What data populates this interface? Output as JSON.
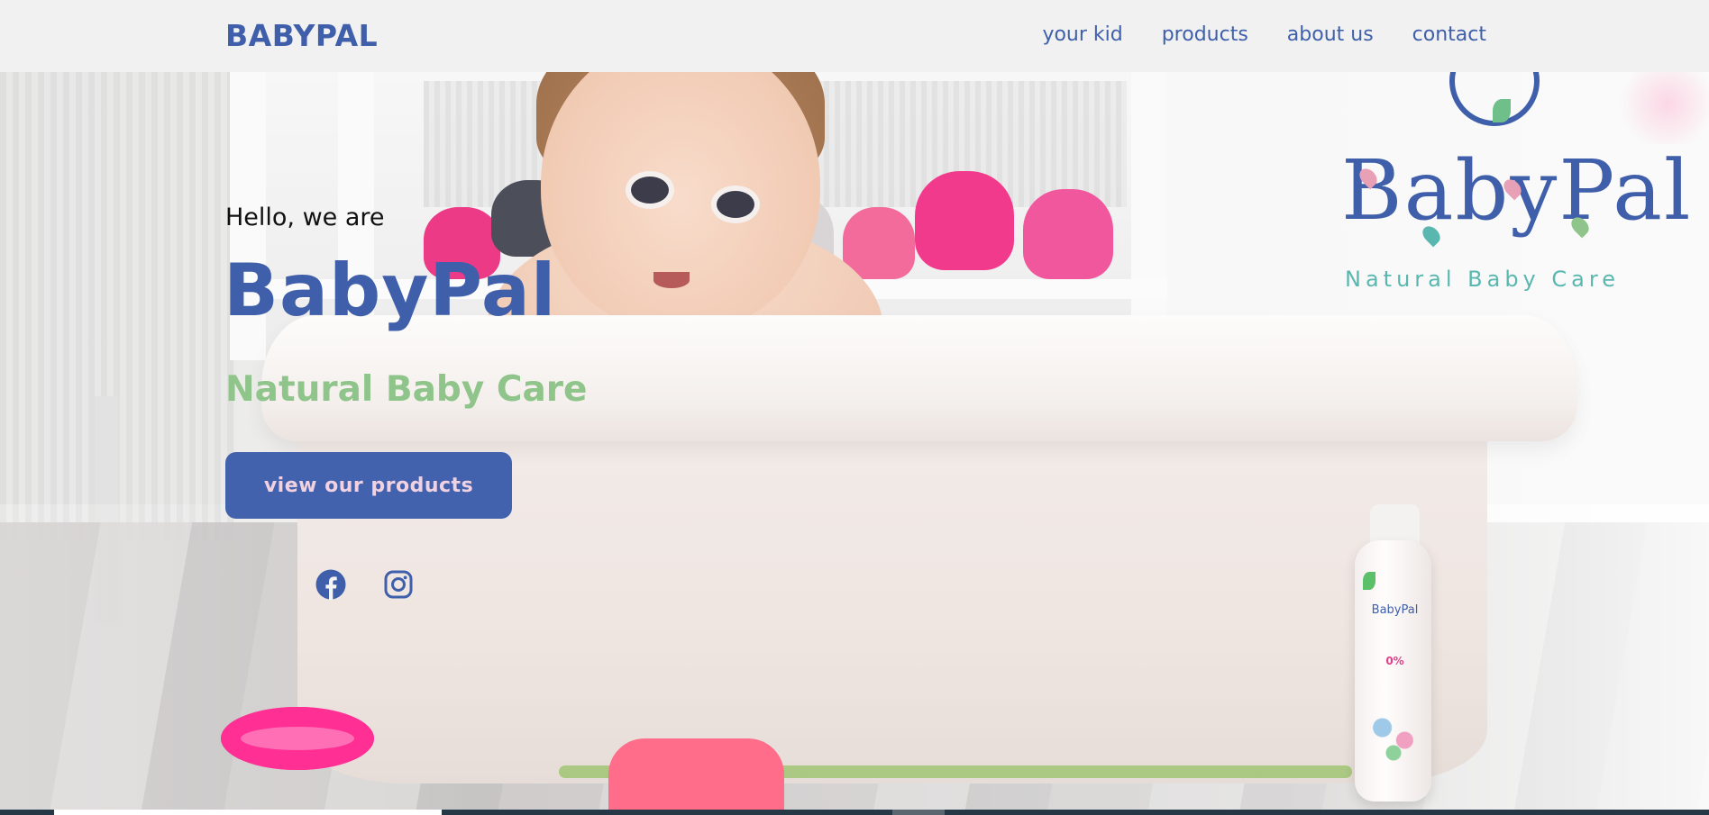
{
  "header": {
    "brand": "BABYPAL",
    "nav": [
      {
        "label": "your kid"
      },
      {
        "label": "products"
      },
      {
        "label": "about us"
      },
      {
        "label": "contact"
      }
    ]
  },
  "hero": {
    "greeting": "Hello, we are",
    "title": "BabyPal",
    "tagline": "Natural Baby Care",
    "cta_label": "view our products",
    "social": [
      {
        "name": "facebook",
        "icon": "facebook-icon"
      },
      {
        "name": "instagram",
        "icon": "instagram-icon"
      }
    ]
  },
  "logo": {
    "wordmark": "BabyPal",
    "tagline": "Natural Baby Care"
  },
  "product": {
    "bottle_brand": "BabyPal",
    "bottle_badge": "0%"
  },
  "colors": {
    "brand_blue": "#3f5fab",
    "button_blue": "#4262ad",
    "tagline_green": "#8fc48a",
    "logo_teal": "#5ab7b0",
    "header_bg": "#f1f1f1"
  }
}
